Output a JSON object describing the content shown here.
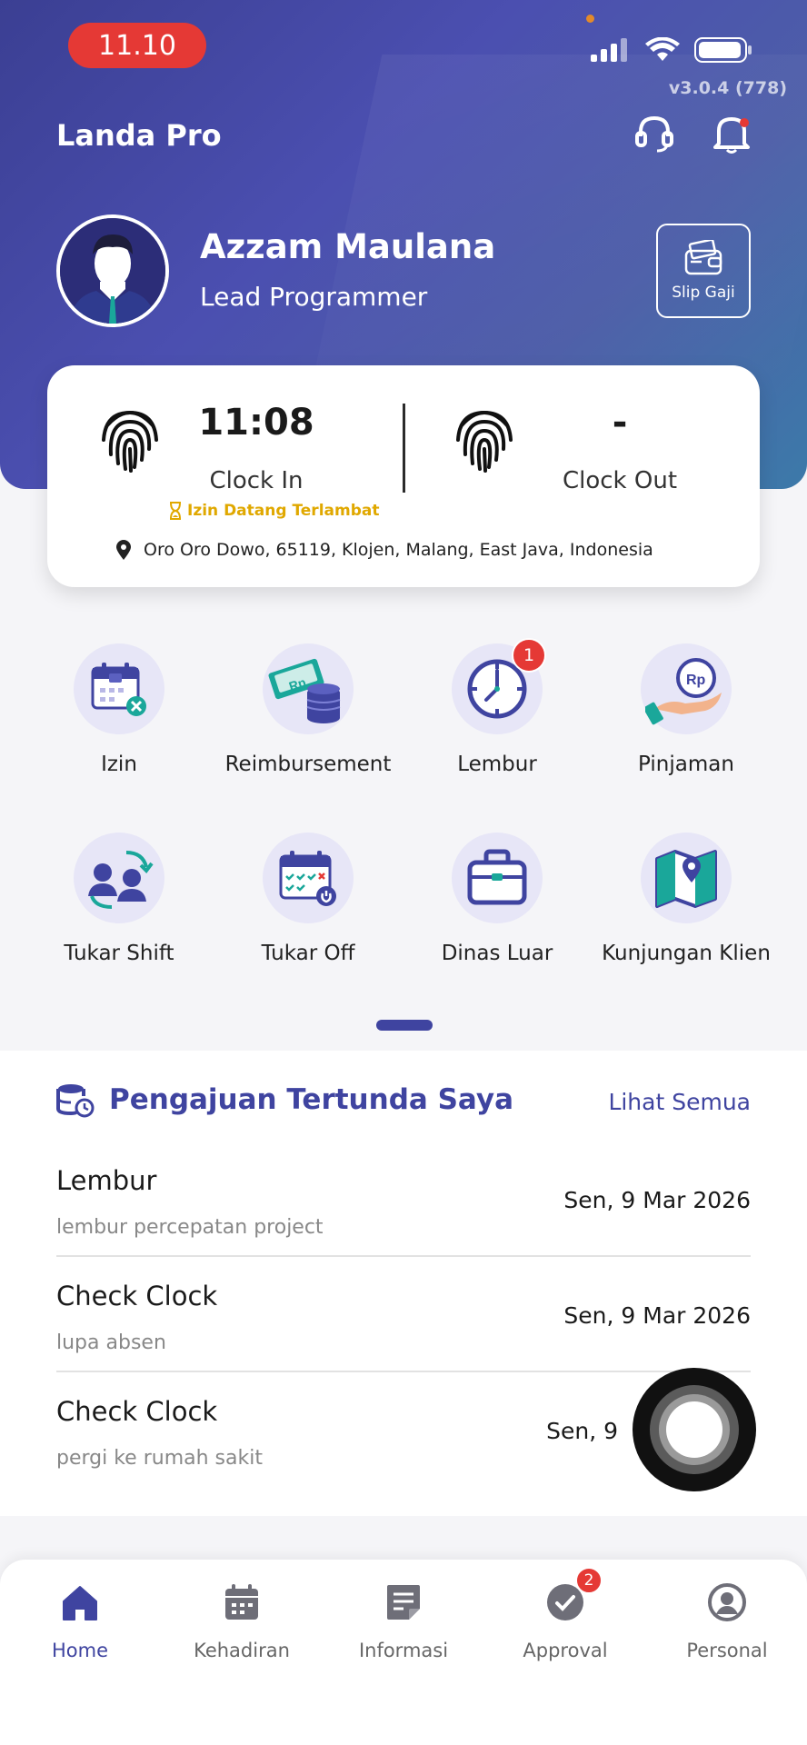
{
  "status_bar": {
    "time": "11.10",
    "version": "v3.0.4 (778)"
  },
  "header": {
    "app_title": "Landa Pro",
    "support_icon": "headset-icon",
    "notification_icon": "bell-icon"
  },
  "profile": {
    "name": "Azzam Maulana",
    "role": "Lead Programmer",
    "slip_label": "Slip Gaji"
  },
  "attendance": {
    "clock_in_time": "11:08",
    "clock_in_label": "Clock In",
    "clock_out_time": "-",
    "clock_out_label": "Clock Out",
    "late_note": "Izin Datang Terlambat",
    "location": "Oro Oro Dowo, 65119, Klojen, Malang, East Java, Indonesia"
  },
  "menu": {
    "items": [
      {
        "label": "Izin",
        "icon": "calendar-cancel-icon"
      },
      {
        "label": "Reimbursement",
        "icon": "money-stack-icon"
      },
      {
        "label": "Lembur",
        "icon": "clock-icon",
        "badge": "1"
      },
      {
        "label": "Pinjaman",
        "icon": "loan-hand-icon"
      },
      {
        "label": "Tukar Shift",
        "icon": "swap-users-icon"
      },
      {
        "label": "Tukar Off",
        "icon": "calendar-off-icon"
      },
      {
        "label": "Dinas Luar",
        "icon": "briefcase-icon"
      },
      {
        "label": "Kunjungan Klien",
        "icon": "map-pin-icon"
      }
    ]
  },
  "pending": {
    "title": "Pengajuan Tertunda Saya",
    "see_all": "Lihat Semua",
    "rows": [
      {
        "type": "Lembur",
        "desc": "lembur percepatan project",
        "date": "Sen, 9 Mar 2026"
      },
      {
        "type": "Check Clock",
        "desc": "lupa absen",
        "date": "Sen, 9 Mar 2026"
      },
      {
        "type": "Check Clock",
        "desc": "pergi ke rumah sakit",
        "date": "Sen, 9"
      }
    ]
  },
  "bottom_nav": {
    "items": [
      {
        "label": "Home",
        "icon": "home-icon"
      },
      {
        "label": "Kehadiran",
        "icon": "calendar-icon"
      },
      {
        "label": "Informasi",
        "icon": "document-icon"
      },
      {
        "label": "Approval",
        "icon": "check-circle-icon",
        "badge": "2"
      },
      {
        "label": "Personal",
        "icon": "user-circle-icon"
      }
    ]
  },
  "colors": {
    "primary": "#3F44A0",
    "alert": "#E53935",
    "warning": "#E0A800"
  }
}
